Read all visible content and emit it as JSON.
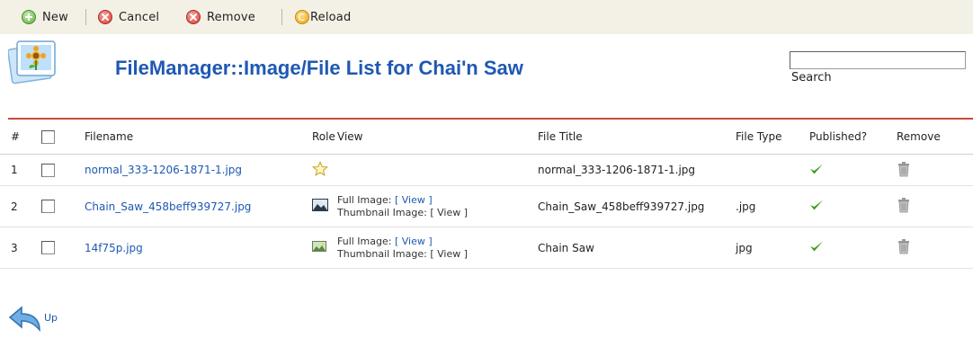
{
  "toolbar": {
    "new_label": "New",
    "cancel_label": "Cancel",
    "remove_label": "Remove",
    "reload_label": "Reload"
  },
  "header": {
    "title": "FileManager::Image/File List for Chai'n Saw"
  },
  "search": {
    "value": "",
    "button_label": "Search"
  },
  "table": {
    "columns": [
      "#",
      "",
      "Filename",
      "Role",
      "View",
      "File Title",
      "File Type",
      "Published?",
      "Remove"
    ],
    "rows": [
      {
        "num": "1",
        "filename": "normal_333-1206-1871-1.jpg",
        "role_icon": "star-icon",
        "view_full_label": "",
        "view_full_link": "",
        "view_thumb_label": "",
        "file_title": "normal_333-1206-1871-1.jpg",
        "file_type": "",
        "published": true
      },
      {
        "num": "2",
        "filename": "Chain_Saw_458beff939727.jpg",
        "role_icon": "image-icon",
        "view_full_label": "Full Image: ",
        "view_full_link": "[ View ]",
        "view_thumb_label": "Thumbnail Image: [ View ]",
        "file_title": "Chain_Saw_458beff939727.jpg",
        "file_type": ".jpg",
        "published": true
      },
      {
        "num": "3",
        "filename": "14f75p.jpg",
        "role_icon": "thumbnail-icon",
        "view_full_label": "Full Image: ",
        "view_full_link": "[ View ]",
        "view_thumb_label": "Thumbnail Image: [ View ]",
        "file_title": "Chain Saw",
        "file_type": "jpg",
        "published": true
      }
    ]
  },
  "footer": {
    "up_label": "Up"
  },
  "colors": {
    "title_blue": "#1f58b3",
    "accent_rule": "#c94a3a",
    "toolbar_bg": "#f3f1e6",
    "check_green": "#3a9d1c"
  }
}
